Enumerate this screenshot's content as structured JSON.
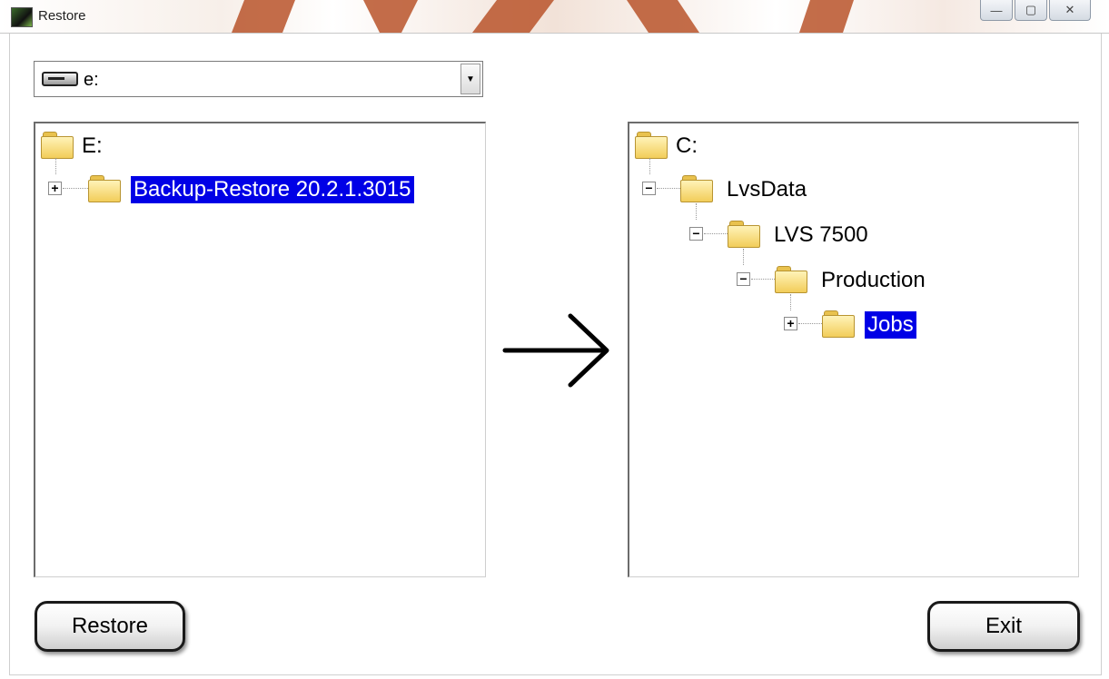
{
  "window": {
    "title": "Restore",
    "controls": {
      "minimize": "—",
      "maximize": "▢",
      "close": "✕"
    }
  },
  "drive_selector": {
    "value": "e:",
    "arrow": "▼",
    "icon": "drive-icon"
  },
  "source_tree": {
    "root": {
      "label": "E:"
    },
    "items": [
      {
        "label": "Backup-Restore 20.2.1.3015",
        "expander": "+",
        "selected": true
      }
    ]
  },
  "destination_tree": {
    "root": {
      "label": "C:"
    },
    "items": [
      {
        "label": "LvsData",
        "expander": "−",
        "selected": false
      },
      {
        "label": "LVS 7500",
        "expander": "−",
        "selected": false
      },
      {
        "label": "Production",
        "expander": "−",
        "selected": false
      },
      {
        "label": "Jobs",
        "expander": "+",
        "selected": true
      }
    ]
  },
  "arrow": {
    "icon": "right-arrow-icon"
  },
  "buttons": {
    "restore": "Restore",
    "exit": "Exit"
  },
  "colors": {
    "selection": "#0000e6",
    "folder": "#f2cd5a",
    "titlebar_accent": "#b9532a"
  }
}
